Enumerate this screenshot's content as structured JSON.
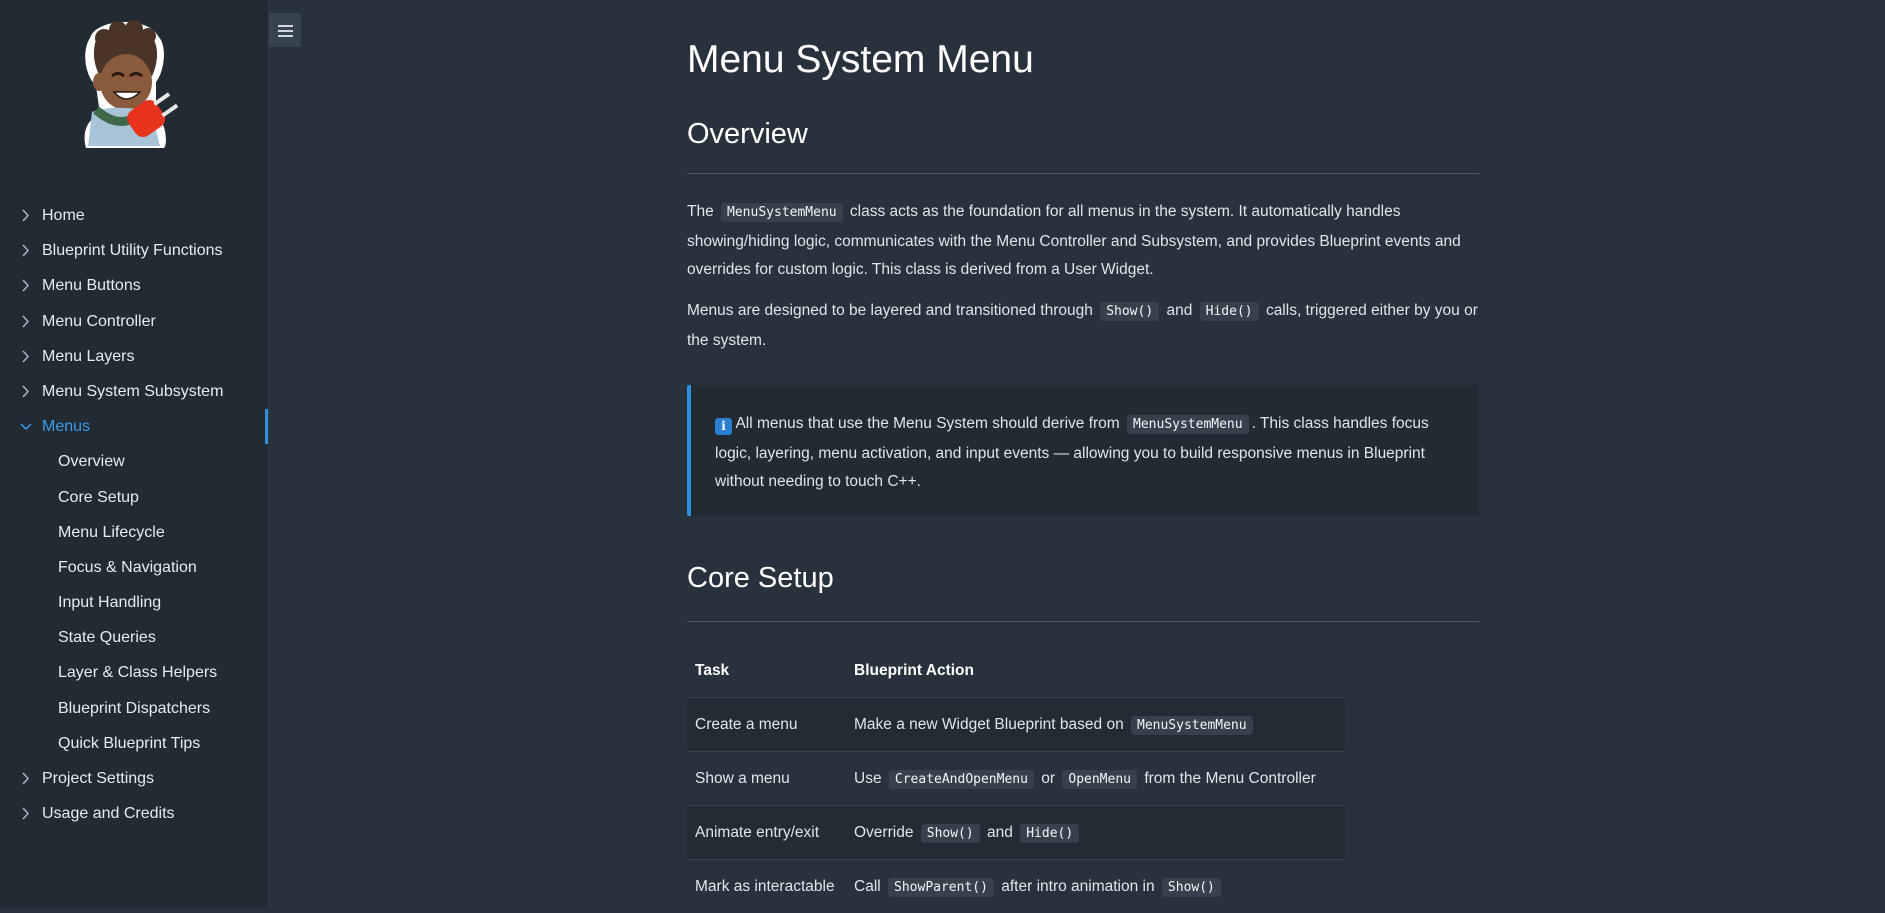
{
  "sidebar": {
    "logo": {
      "icon": "character-plug-logo"
    },
    "items": [
      {
        "label": "Home"
      },
      {
        "label": "Blueprint Utility Functions"
      },
      {
        "label": "Menu Buttons"
      },
      {
        "label": "Menu Controller"
      },
      {
        "label": "Menu Layers"
      },
      {
        "label": "Menu System Subsystem"
      },
      {
        "label": "Menus"
      },
      {
        "label": "Project Settings"
      },
      {
        "label": "Usage and Credits"
      }
    ],
    "active_item": "Menus",
    "sub_items": [
      {
        "label": "Overview"
      },
      {
        "label": "Core Setup"
      },
      {
        "label": "Menu Lifecycle"
      },
      {
        "label": "Focus & Navigation"
      },
      {
        "label": "Input Handling"
      },
      {
        "label": "State Queries"
      },
      {
        "label": "Layer & Class Helpers"
      },
      {
        "label": "Blueprint Dispatchers"
      },
      {
        "label": "Quick Blueprint Tips"
      }
    ]
  },
  "toolbar": {
    "menu_toggle_icon": "hamburger-icon"
  },
  "page": {
    "title": "Menu System Menu",
    "overview": {
      "heading": "Overview",
      "p1": {
        "t1": "The",
        "code1": "MenuSystemMenu",
        "t2": "class acts as the foundation for all menus in the system. It automatically handles showing/hiding logic, communicates with the Menu Controller and Subsystem, and provides Blueprint events and overrides for custom logic. This class is derived from a User Widget."
      },
      "p2": {
        "t1": "Menus are designed to be layered and transitioned through",
        "code1": "Show()",
        "t2": "and",
        "code2": "Hide()",
        "t3": "calls, triggered either by you or the system."
      },
      "note": {
        "icon_text": "i",
        "t1": "All menus that use the Menu System should derive from",
        "code1": "MenuSystemMenu",
        "t2": ". This class handles focus logic, layering, menu activation, and input events — allowing you to build responsive menus in Blueprint without needing to touch C++."
      }
    },
    "core_setup": {
      "heading": "Core Setup",
      "columns": [
        "Task",
        "Blueprint Action"
      ],
      "rows": [
        {
          "task": "Create a menu",
          "a1": "Make a new Widget Blueprint based on",
          "c1": "MenuSystemMenu"
        },
        {
          "task": "Show a menu",
          "a1": "Use",
          "c1": "CreateAndOpenMenu",
          "a2": "or",
          "c2": "OpenMenu",
          "a3": "from the Menu Controller"
        },
        {
          "task": "Animate entry/exit",
          "a1": "Override",
          "c1": "Show()",
          "a2": "and",
          "c2": "Hide()"
        },
        {
          "task": "Mark as interactable",
          "a1": "Call",
          "c1": "ShowParent()",
          "a2": "after intro animation in",
          "c2": "Show()"
        }
      ]
    }
  },
  "colors": {
    "accent": "#2f8fe0",
    "background": "#28323c",
    "sidebar": "#222b34"
  }
}
